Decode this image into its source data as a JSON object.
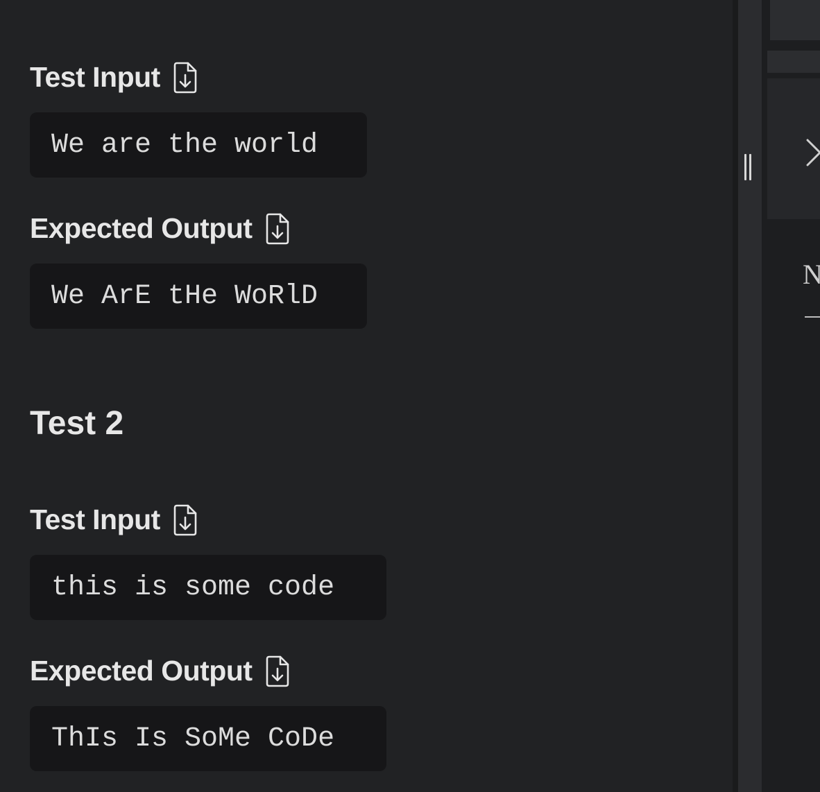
{
  "tests": [
    {
      "input_heading": "Test Input",
      "input_value": "We are the world",
      "output_heading": "Expected Output",
      "output_value": "We ArE tHe WoRlD"
    },
    {
      "title": "Test 2",
      "input_heading": "Test Input",
      "input_value": "this is some code",
      "output_heading": "Expected Output",
      "output_value": "ThIs Is SoMe CoDe"
    }
  ],
  "icons": {
    "download_file": "file-download-icon",
    "resize_handle": "drag-handle-icon",
    "close": "close-icon"
  },
  "right_panel": {
    "partial_text": "N"
  },
  "colors": {
    "panel_bg": "#212224",
    "code_bg": "#161618",
    "text": "#e7e7e7"
  }
}
